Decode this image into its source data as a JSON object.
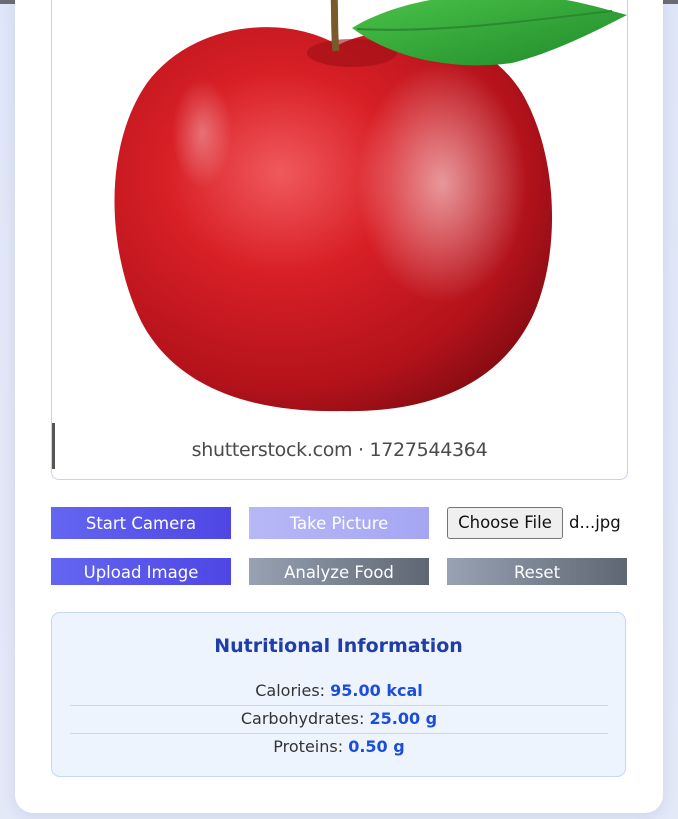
{
  "photo": {
    "watermark": "shutterstock.com · 1727544364",
    "subject": "red apple with green leaf"
  },
  "controls": {
    "start_camera": "Start Camera",
    "take_picture": "Take Picture",
    "choose_file": "Choose File",
    "file_name": "d...jpg",
    "upload_image": "Upload Image",
    "analyze_food": "Analyze Food",
    "reset": "Reset"
  },
  "nutrition": {
    "title": "Nutritional Information",
    "rows": [
      {
        "label": "Calories:",
        "value": "95.00 kcal"
      },
      {
        "label": "Carbohydrates:",
        "value": "25.00 g"
      },
      {
        "label": "Proteins:",
        "value": "0.50 g"
      }
    ]
  },
  "colors": {
    "primary": "#4f46e5",
    "primary_disabled": "#a5a6f3",
    "gray": "#5f6673",
    "value_blue": "#1d4ed8",
    "title_blue": "#1f3ea8"
  }
}
